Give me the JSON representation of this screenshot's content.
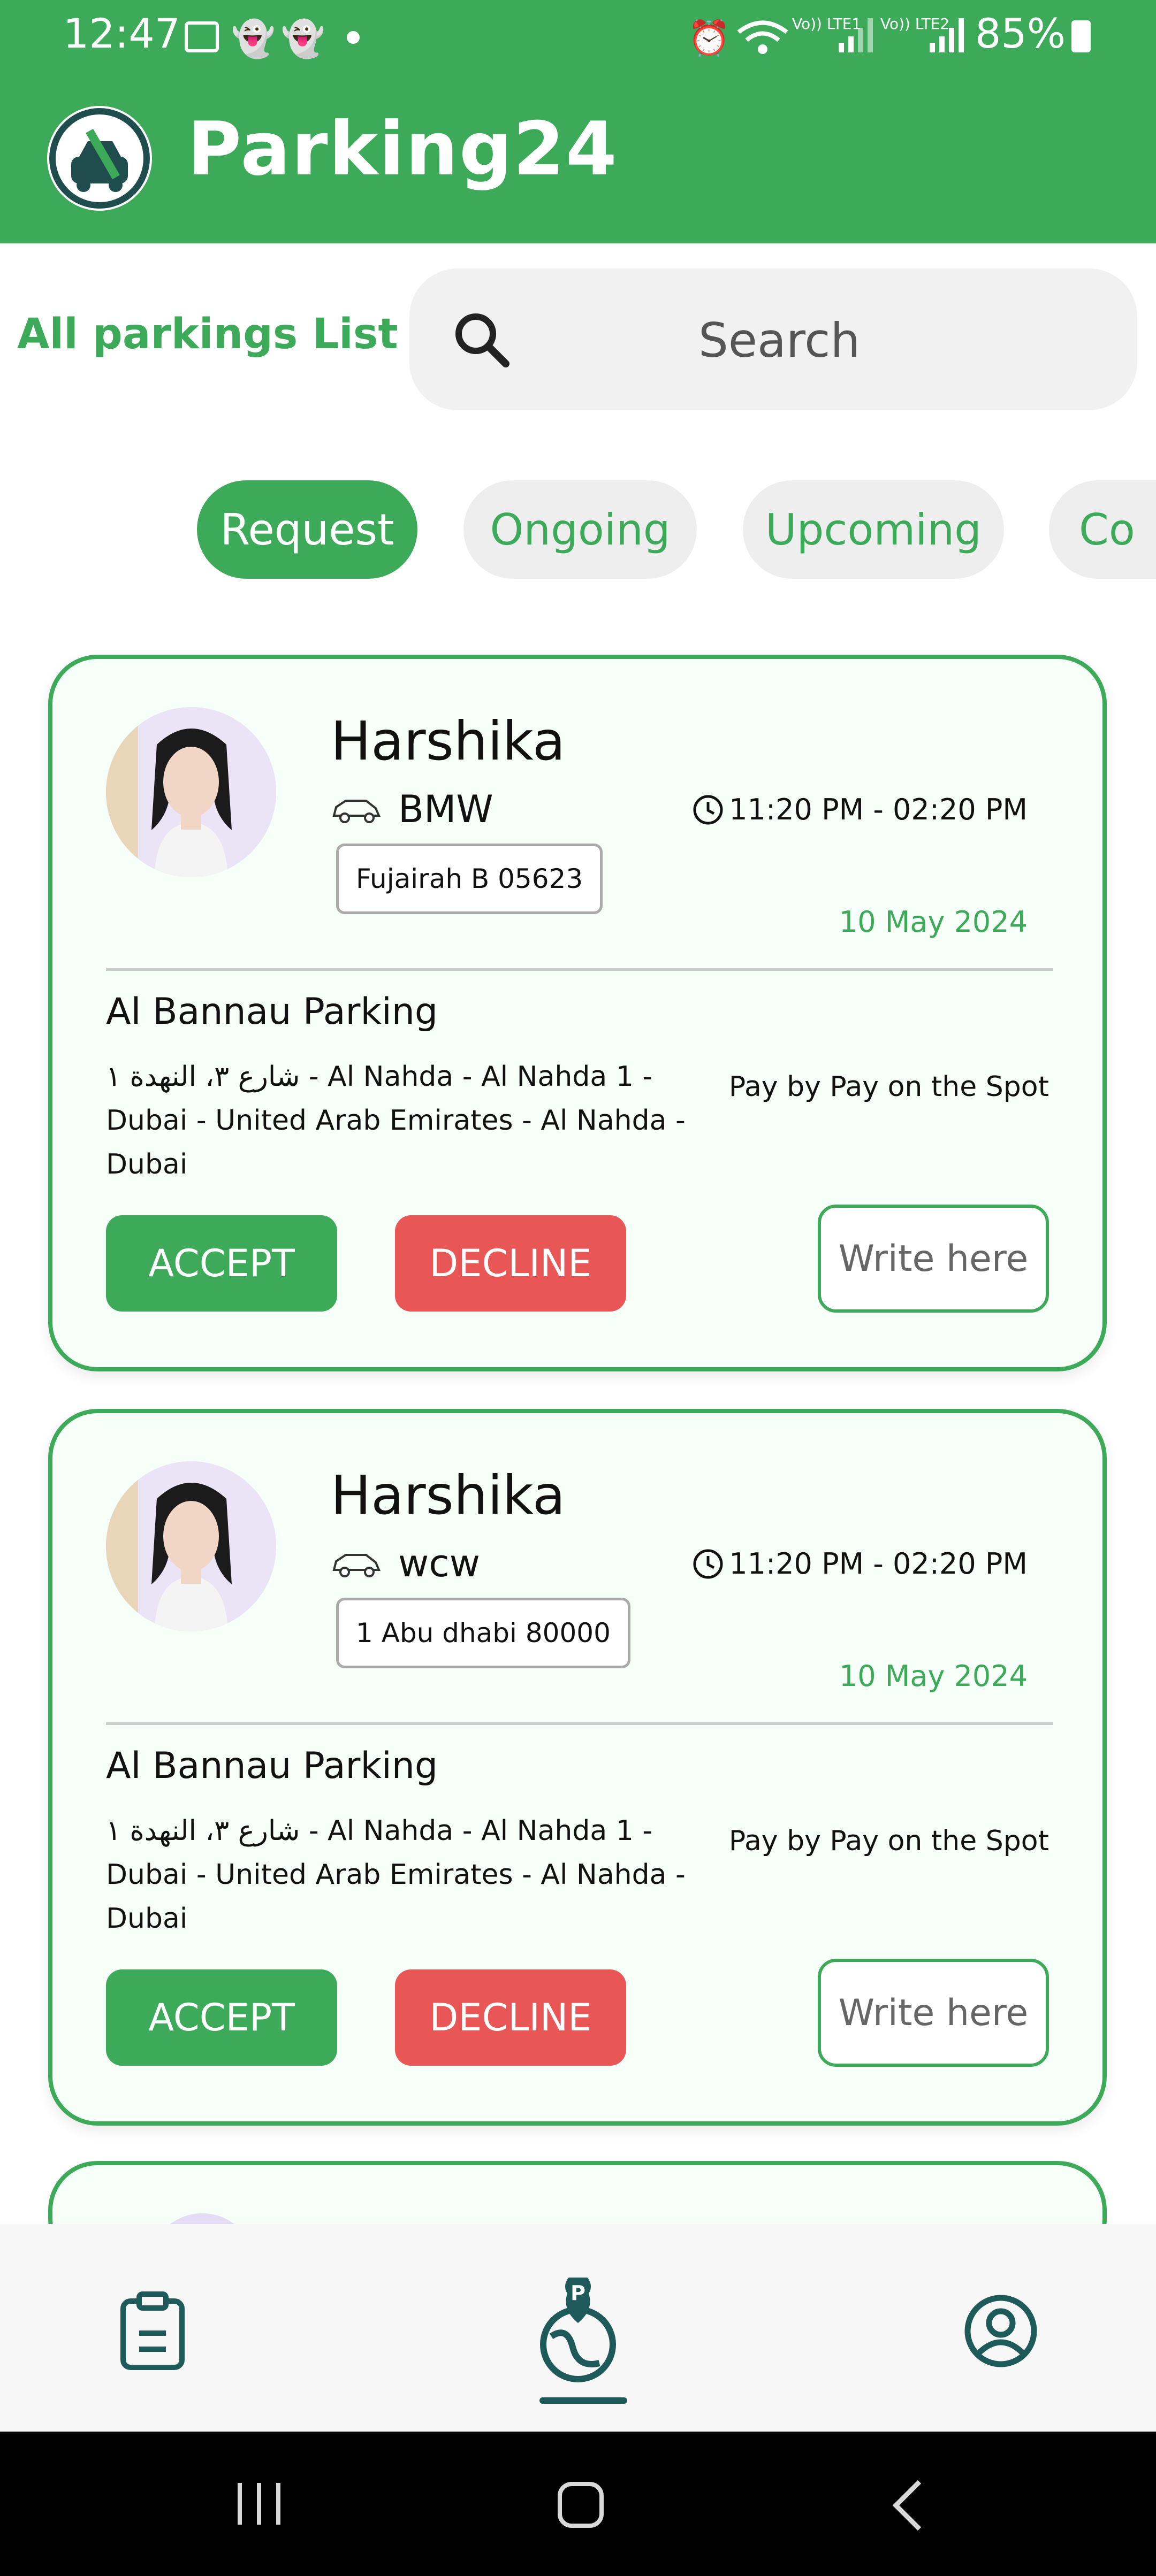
{
  "status_bar": {
    "time": "12:47",
    "battery": "85%",
    "left_icons": [
      "gallery-icon",
      "snapchat-icon",
      "snapchat-icon",
      "dot-icon"
    ],
    "right_icons": [
      "alarm-icon",
      "wifi-icon",
      "signal-lte1-icon",
      "signal-lte2-icon",
      "battery-icon"
    ],
    "lte1": "Vo)) LTE1",
    "lte2": "Vo)) LTE2"
  },
  "header": {
    "app_title": "Parking24",
    "logo_icon": "parking-logo-icon",
    "color": "#3daa59"
  },
  "search": {
    "list_title": "All parkings List",
    "placeholder": "Search",
    "icon": "search-icon"
  },
  "tabs": [
    {
      "label": "Request",
      "active": true
    },
    {
      "label": "Ongoing",
      "active": false
    },
    {
      "label": "Upcoming",
      "active": false
    },
    {
      "label": "Co",
      "active": false
    }
  ],
  "bookings": [
    {
      "name": "Harshika",
      "car": "BMW",
      "plate": "Fujairah B 05623",
      "time": "11:20 PM - 02:20 PM",
      "date": "10 May 2024",
      "parking_name": "Al Bannau Parking",
      "address": "شارع ٣، النهدة ١ - Al Nahda - Al Nahda 1 - Dubai - United Arab Emirates - Al Nahda - Dubai",
      "payment": "Pay by Pay on the Spot",
      "accept_label": "ACCEPT",
      "decline_label": "DECLINE",
      "write_placeholder": "Write here"
    },
    {
      "name": "Harshika",
      "car": "wcw",
      "plate": "1 Abu dhabi 80000",
      "time": "11:20 PM - 02:20 PM",
      "date": "10 May 2024",
      "parking_name": "Al Bannau Parking",
      "address": "شارع ٣، النهدة ١ - Al Nahda - Al Nahda 1 - Dubai - United Arab Emirates - Al Nahda - Dubai",
      "payment": "Pay by Pay on the Spot",
      "accept_label": "ACCEPT",
      "decline_label": "DECLINE",
      "write_placeholder": "Write here"
    }
  ],
  "bottom_nav": {
    "items": [
      "clipboard-icon",
      "parking-map-icon",
      "profile-icon"
    ],
    "active_index": 1
  },
  "colors": {
    "accent": "#3daa59",
    "decline": "#e95656",
    "nav_icon": "#1f5a5a"
  }
}
